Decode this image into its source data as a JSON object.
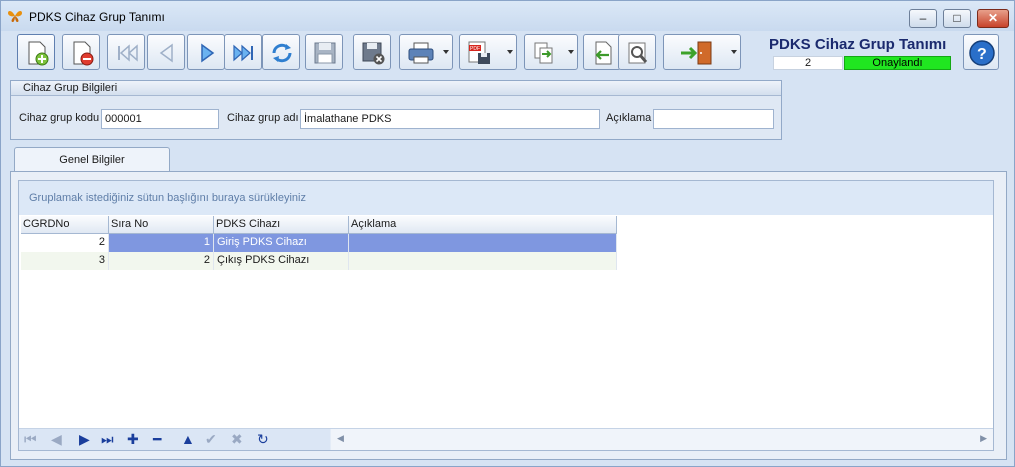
{
  "window": {
    "title": "PDKS Cihaz Grup Tanımı",
    "controls": {
      "minimize": "–",
      "maximize": "□",
      "close": "✕"
    }
  },
  "toolbar": {
    "buttons": [
      {
        "name": "new-record",
        "icon": "new-document-icon"
      },
      {
        "name": "delete-record",
        "icon": "delete-document-icon"
      },
      {
        "name": "first-record",
        "icon": "first-icon"
      },
      {
        "name": "previous-record",
        "icon": "previous-icon"
      },
      {
        "name": "next-record",
        "icon": "next-icon"
      },
      {
        "name": "last-record",
        "icon": "last-icon"
      },
      {
        "name": "refresh",
        "icon": "refresh-icon"
      },
      {
        "name": "save",
        "icon": "save-icon"
      },
      {
        "name": "cancel-save",
        "icon": "save-cancel-icon"
      },
      {
        "name": "print",
        "icon": "printer-icon"
      },
      {
        "name": "export-pdf",
        "icon": "pdf-icon"
      },
      {
        "name": "export",
        "icon": "export-icon"
      },
      {
        "name": "import",
        "icon": "import-icon"
      },
      {
        "name": "tools",
        "icon": "tools-icon"
      },
      {
        "name": "exit",
        "icon": "exit-door-icon"
      }
    ]
  },
  "header": {
    "title": "PDKS Cihaz Grup Tanımı",
    "record_number": "2",
    "status": "Onaylandı",
    "status_color": "#20e620"
  },
  "group_box": {
    "title": "Cihaz Grup Bilgileri",
    "fields": {
      "code_label": "Cihaz grup kodu",
      "code_value": "000001",
      "name_label": "Cihaz grup adı",
      "name_value": "İmalathane PDKS",
      "description_label": "Açıklama",
      "description_value": ""
    }
  },
  "tabs": [
    {
      "label": "Genel Bilgiler",
      "active": true
    }
  ],
  "grid": {
    "group_panel_text": "Gruplamak istediğiniz sütun başlığını buraya sürükleyiniz",
    "columns": [
      "CGRDNo",
      "Sıra No",
      "PDKS Cihazı",
      "Açıklama"
    ],
    "rows": [
      {
        "cgrdno": "2",
        "sira_no": "1",
        "cihaz": "Giriş PDKS Cihazı",
        "aciklama": "",
        "selected": true
      },
      {
        "cgrdno": "3",
        "sira_no": "2",
        "cihaz": "Çıkış PDKS Cihazı",
        "aciklama": "",
        "selected": false
      }
    ],
    "selection_color": "#7f97e0",
    "navigator": {
      "first": "⏮",
      "prev": "◀",
      "next": "▶",
      "last": "⏭",
      "add": "✚",
      "remove": "━",
      "up": "▲",
      "confirm": "✔",
      "cancel": "✖",
      "refresh": "↻"
    }
  }
}
